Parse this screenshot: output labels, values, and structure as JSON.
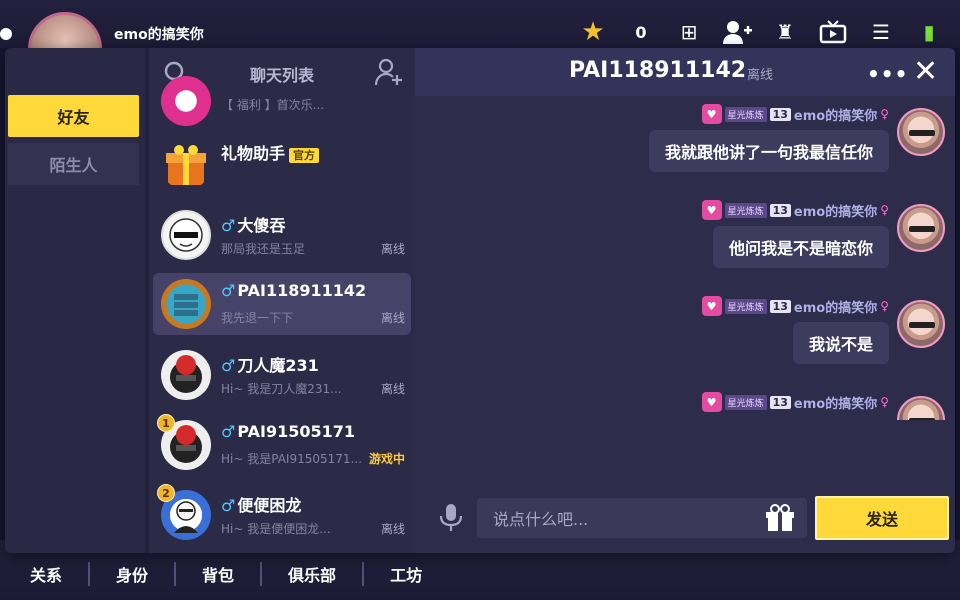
{
  "background": {
    "username": "emo的搞笑你",
    "coin_count": "0",
    "bottom_tabs": [
      "关系",
      "身份",
      "背包",
      "俱乐部",
      "工坊"
    ]
  },
  "nav": {
    "friends_label": "好友",
    "strangers_label": "陌生人"
  },
  "list": {
    "title": "聊天列表",
    "items": [
      {
        "name": "",
        "preview": "【 福利 】首次乐...",
        "status": ""
      },
      {
        "name": "礼物助手",
        "badge": "官方",
        "preview": "",
        "status": ""
      },
      {
        "name": "大傻吞",
        "preview": "那局我还是玉足",
        "status": "离线"
      },
      {
        "name": "PAI118911142",
        "preview": "我先退一下下",
        "status": "离线"
      },
      {
        "name": "刀人魔231",
        "preview": "Hi~ 我是刀人魔231...",
        "status": "离线"
      },
      {
        "name": "PAI91505171",
        "preview": "Hi~ 我是PAI91505171...",
        "status": "游戏中",
        "rank": "1"
      },
      {
        "name": "便便困龙",
        "preview": "Hi~ 我是便便困龙...",
        "status": "离线",
        "rank": "2"
      }
    ]
  },
  "conversation": {
    "title": "PAI118911142",
    "status": "离线",
    "messages": [
      {
        "sender": "emo的搞笑你",
        "tag": "星光炼炼",
        "level": "13",
        "text": "我就跟他讲了一句我最信任你"
      },
      {
        "sender": "emo的搞笑你",
        "tag": "星光炼炼",
        "level": "13",
        "text": "他问我是不是暗恋你"
      },
      {
        "sender": "emo的搞笑你",
        "tag": "星光炼炼",
        "level": "13",
        "text": "我说不是"
      },
      {
        "sender": "emo的搞笑你",
        "tag": "星光炼炼",
        "level": "13",
        "text": ""
      }
    ]
  },
  "composer": {
    "placeholder": "说点什么吧...",
    "send_label": "发送"
  },
  "colors": {
    "accent_yellow": "#ffd93a",
    "window_bg": "#23223d",
    "male_blue": "#53c6ff",
    "female_pink": "#ff66d6"
  }
}
